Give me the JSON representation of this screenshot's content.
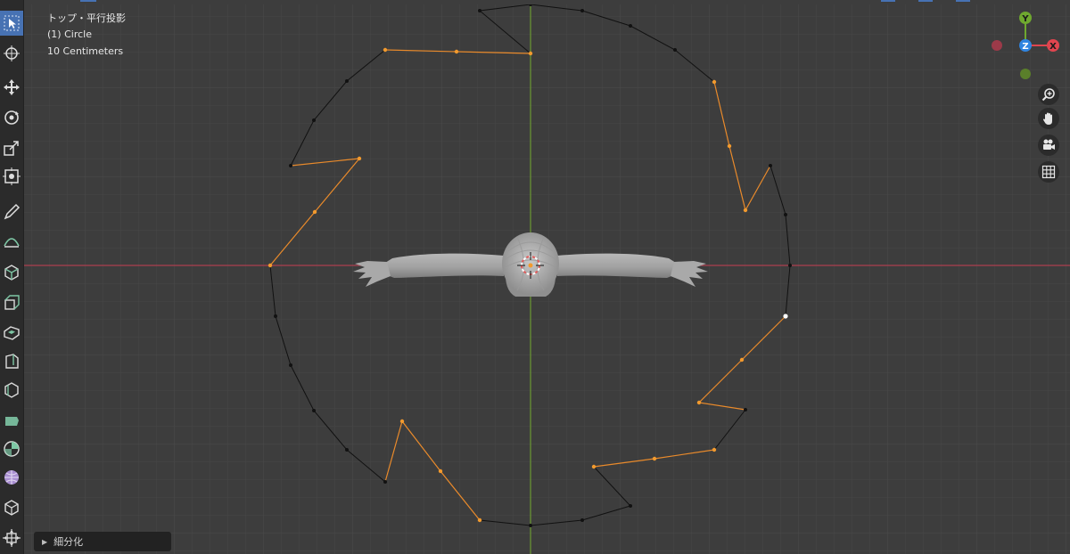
{
  "overlay": {
    "view_name": "トップ・平行投影",
    "object_name": "(1) Circle",
    "grid_scale": "10 Centimeters"
  },
  "redo_panel": {
    "label": "細分化"
  },
  "gizmo": {
    "y_label": "Y",
    "z_label": "Z",
    "x_label": "X",
    "colors": {
      "x": "#e0454f",
      "y": "#6fa82f",
      "z": "#2f84e0"
    }
  },
  "toolbar": {
    "tools": [
      "select-box",
      "cursor",
      "move",
      "rotate",
      "scale",
      "transform",
      "annotate",
      "measure",
      "add-cube",
      "extrude-region",
      "inset-faces",
      "bevel",
      "loop-cut",
      "knife",
      "poly-build",
      "spin",
      "smooth",
      "shrink-fatten",
      "shear"
    ]
  },
  "nav_buttons": [
    "zoom",
    "pan",
    "camera",
    "orthographic-toggle"
  ],
  "colors": {
    "background": "#3d3d3d",
    "grid_minor": "#464646",
    "grid_major": "#4e4e4e",
    "x_axis": "#ad3f50",
    "y_axis": "#6c9a33",
    "edge_selected": "#e98a2b",
    "edge_unselected": "#111111",
    "active_vertex": "#ffffff"
  }
}
